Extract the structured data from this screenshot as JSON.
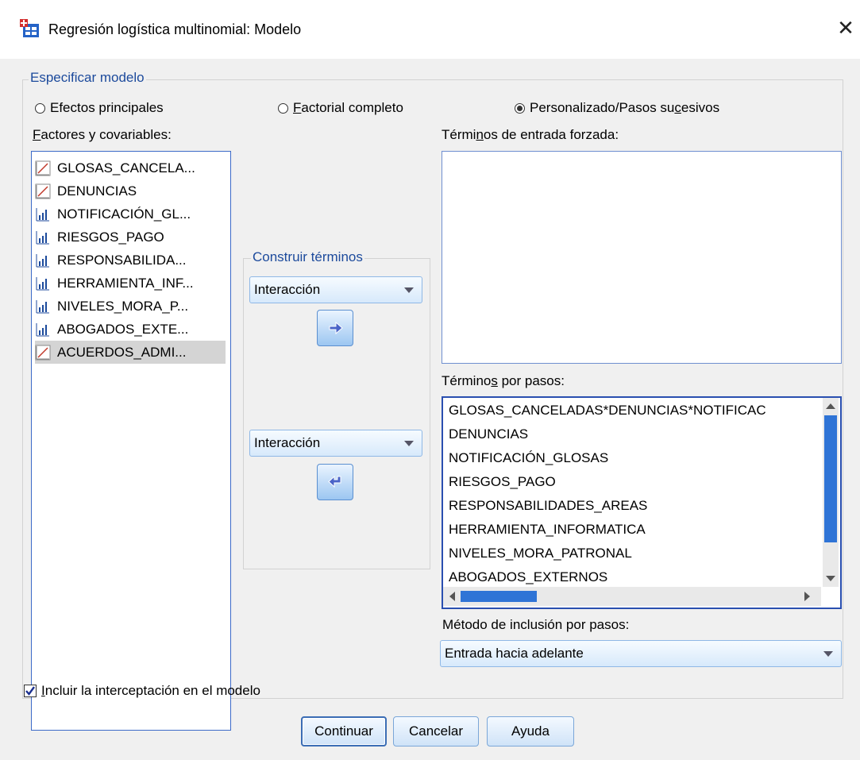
{
  "window": {
    "title": "Regresión logística multinomial: Modelo"
  },
  "model_group": {
    "legend": "Especificar modelo",
    "radios": [
      {
        "label": "Efectos principales",
        "selected": false
      },
      {
        "label_pre": "F",
        "label_rest": "actorial completo",
        "selected": false
      },
      {
        "label_pre": "Personalizado/Pasos su",
        "label_u": "c",
        "label_post": "esivos",
        "selected": true
      }
    ]
  },
  "factors": {
    "label_u": "F",
    "label_rest": "actores y covariables:",
    "items": [
      {
        "label": "GLOSAS_CANCELA...",
        "type": "scale",
        "icon": "scale-icon"
      },
      {
        "label": "DENUNCIAS",
        "type": "scale",
        "icon": "scale-icon"
      },
      {
        "label": "NOTIFICACIÓN_GL...",
        "type": "ordinal",
        "icon": "ordinal-icon"
      },
      {
        "label": "RIESGOS_PAGO",
        "type": "ordinal",
        "icon": "ordinal-icon"
      },
      {
        "label": "RESPONSABILIDA...",
        "type": "ordinal",
        "icon": "ordinal-icon"
      },
      {
        "label": "HERRAMIENTA_INF...",
        "type": "ordinal",
        "icon": "ordinal-icon"
      },
      {
        "label": "NIVELES_MORA_P...",
        "type": "ordinal",
        "icon": "ordinal-icon"
      },
      {
        "label": "ABOGADOS_EXTE...",
        "type": "ordinal",
        "icon": "ordinal-icon"
      },
      {
        "label": "ACUERDOS_ADMI...",
        "type": "scale",
        "icon": "scale-icon",
        "selected": true
      }
    ]
  },
  "build_terms": {
    "legend": "Construir términos",
    "combo_top": "Interacción",
    "combo_bottom": "Interacción"
  },
  "forced_terms": {
    "label_pre": "Térmi",
    "label_u": "n",
    "label_post": "os de entrada forzada:"
  },
  "stepwise_terms": {
    "label_pre": "Término",
    "label_u": "s",
    "label_post": " por pasos:",
    "items": [
      "GLOSAS_CANCELADAS*DENUNCIAS*NOTIFICAC",
      "DENUNCIAS",
      "NOTIFICACIÓN_GLOSAS",
      "RIESGOS_PAGO",
      "RESPONSABILIDADES_AREAS",
      "HERRAMIENTA_INFORMATICA",
      "NIVELES_MORA_PATRONAL",
      "ABOGADOS_EXTERNOS"
    ]
  },
  "method": {
    "label": "Método de inclusión por pasos:",
    "value": "Entrada hacia adelante"
  },
  "intercept": {
    "label_u": "I",
    "label_rest": "ncluir la interceptación en el modelo",
    "checked": true
  },
  "buttons": {
    "continue": "Continuar",
    "cancel": "Cancelar",
    "help": "Ayuda"
  },
  "colors": {
    "accent_blue": "#1c4a9c",
    "list_border": "#3c6ac8",
    "scroll_thumb": "#2f74d6"
  }
}
